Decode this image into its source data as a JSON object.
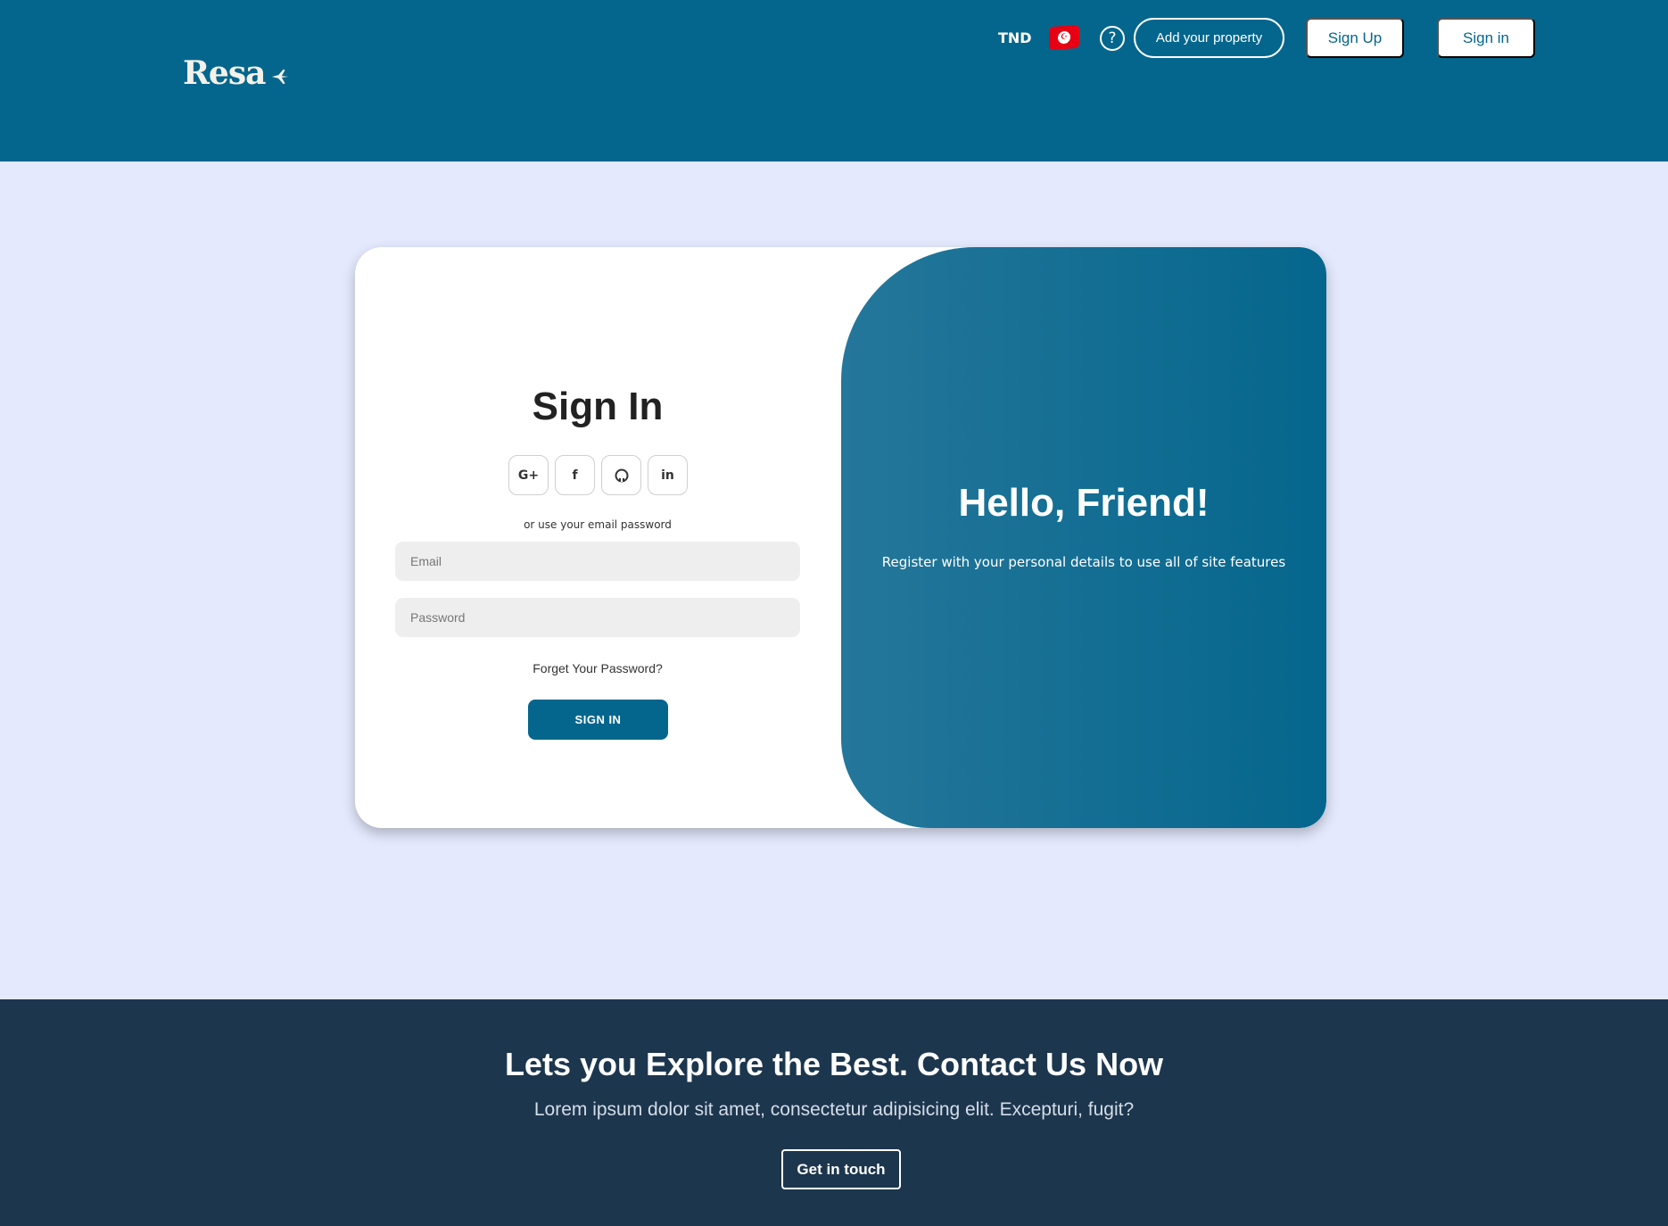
{
  "header": {
    "logo_text": "Resa",
    "currency": "TND",
    "help_icon_glyph": "?",
    "add_property_label": "Add your property",
    "sign_up_label": "Sign Up",
    "sign_in_label": "Sign in"
  },
  "form": {
    "title": "Sign In",
    "socials": [
      {
        "icon": "google-plus-icon",
        "glyph": "G+"
      },
      {
        "icon": "facebook-icon",
        "glyph": "f"
      },
      {
        "icon": "github-icon",
        "glyph": "⊙"
      },
      {
        "icon": "linkedin-icon",
        "glyph": "in"
      }
    ],
    "or_text": "or use your email password",
    "email_placeholder": "Email",
    "email_value": "",
    "password_placeholder": "Password",
    "password_value": "",
    "forgot_label": "Forget Your Password?",
    "submit_label": "SIGN IN"
  },
  "panel": {
    "title": "Hello, Friend!",
    "text": "Register with your personal details to use all of site features"
  },
  "footer": {
    "title": "Lets you Explore the Best. Contact Us Now",
    "text": "Lorem ipsum dolor sit amet, consectetur adipisicing elit. Excepturi, fugit?",
    "button_label": "Get in touch"
  },
  "colors": {
    "brand": "#05668d",
    "page_bg": "#e4e9fd",
    "footer_bg": "#1c364e",
    "flag_red": "#e70013"
  }
}
